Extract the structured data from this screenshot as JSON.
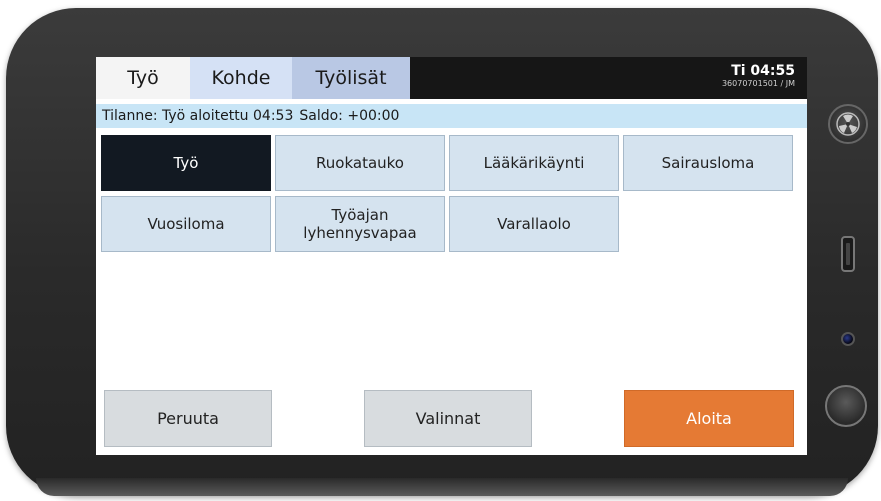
{
  "tabs": [
    {
      "label": "Työ"
    },
    {
      "label": "Kohde"
    },
    {
      "label": "Työlisät"
    }
  ],
  "clock": {
    "time": "Ti 04:55",
    "device_id": "36070701501 / JM"
  },
  "status": {
    "situation": "Tilanne: Työ aloitettu 04:53",
    "balance": "Saldo: +00:00"
  },
  "activities": [
    {
      "label": "Työ",
      "selected": true
    },
    {
      "label": "Ruokatauko",
      "selected": false
    },
    {
      "label": "Lääkärikäynti",
      "selected": false
    },
    {
      "label": "Sairausloma",
      "selected": false
    },
    {
      "label": "Vuosiloma",
      "selected": false
    },
    {
      "label": "Työajan lyhennysvapaa",
      "selected": false
    },
    {
      "label": "Varallaolo",
      "selected": false
    }
  ],
  "actions": {
    "cancel": "Peruuta",
    "options": "Valinnat",
    "start": "Aloita"
  },
  "colors": {
    "start_button": "#e57a34",
    "selected_activity": "#121922",
    "activity_button": "#d5e3ef",
    "status_bar": "#c8e5f6"
  }
}
